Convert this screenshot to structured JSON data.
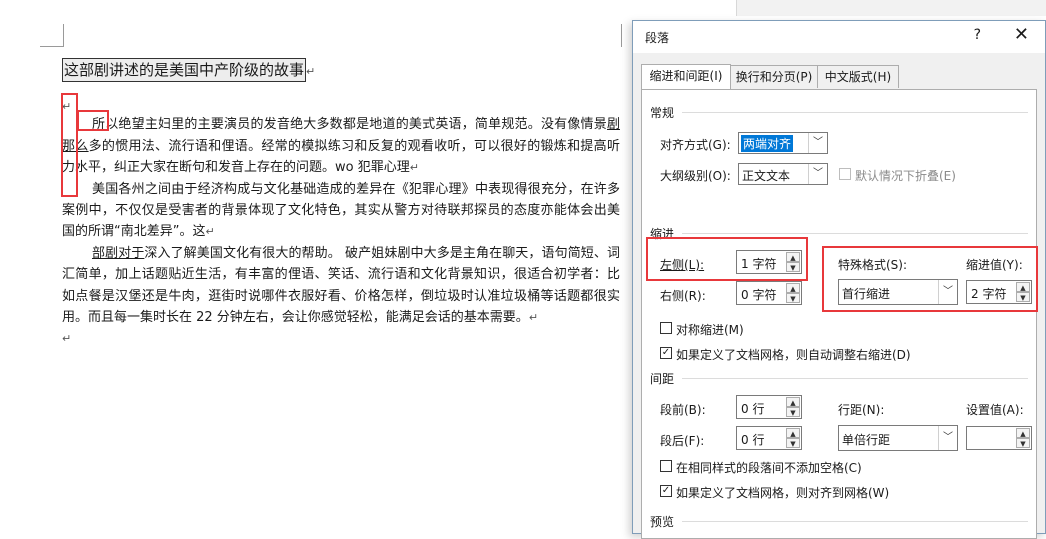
{
  "document": {
    "title": "这部剧讲述的是美国中产阶级的故事",
    "para_mark": "↵",
    "p1": "所以绝望主妇里的主要演员的发音绝大多数都是地道的美式英语，简单规范。没有像情景",
    "p1_und": "剧那么",
    "p1_b": "多的惯用法、流行语和俚语。经常的模拟练习和反复的观看收听，可以很好的锻炼和提高听力水平，纠正大家在断句和发音上存在的问题。wo 犯罪心理",
    "p2": "美国各州之间由于经济构成与文化基础造成的差异在《犯罪心理》中表现得很充分，在许多案例中，不仅仅是受害者的背景体现了文化特色，其实从警方对待联邦探员的态度亦能体会出美国的所谓“南北差异”。这",
    "p3_und": "部剧对于",
    "p3": "深入了解美国文化有很大的帮助。        破产姐妹剧中大多是主角在聊天，语句简短、词汇简单，加上话题贴近生活，有丰富的俚语、笑话、流行语和文化背景知识，很适合初学者：比如点餐是汉堡还是牛肉，逛街时说哪件衣服好看、价格怎样，倒垃圾时认准垃圾桶等话题都很实用。而且每一集时长在 22 分钟左右，会让你感觉轻松，能满足会话的基本需要。"
  },
  "dialog": {
    "title": "段落",
    "help": "?",
    "close": "✕",
    "tabs": [
      "缩进和间距(I)",
      "换行和分页(P)",
      "中文版式(H)"
    ],
    "general": {
      "heading": "常规",
      "alignment_label": "对齐方式(G):",
      "alignment_value": "两端对齐",
      "outline_label": "大纲级别(O):",
      "outline_value": "正文文本",
      "collapse_label": "默认情况下折叠(E)"
    },
    "indent": {
      "heading": "缩进",
      "left_label": "左侧(L):",
      "left_value": "1 字符",
      "right_label": "右侧(R):",
      "right_value": "0 字符",
      "special_label": "特殊格式(S):",
      "special_value": "首行缩进",
      "by_label": "缩进值(Y):",
      "by_value": "2 字符",
      "mirror_label": "对称缩进(M)",
      "auto_label": "如果定义了文档网格，则自动调整右缩进(D)"
    },
    "spacing": {
      "heading": "间距",
      "before_label": "段前(B):",
      "before_value": "0 行",
      "after_label": "段后(F):",
      "after_value": "0 行",
      "line_label": "行距(N):",
      "line_value": "单倍行距",
      "at_label": "设置值(A):",
      "no_space_label": "在相同样式的段落间不添加空格(C)",
      "snap_label": "如果定义了文档网格，则对齐到网格(W)"
    },
    "preview_heading": "预览"
  },
  "colors": {
    "highlight": "#e8383b",
    "selection": "#0078d7"
  }
}
